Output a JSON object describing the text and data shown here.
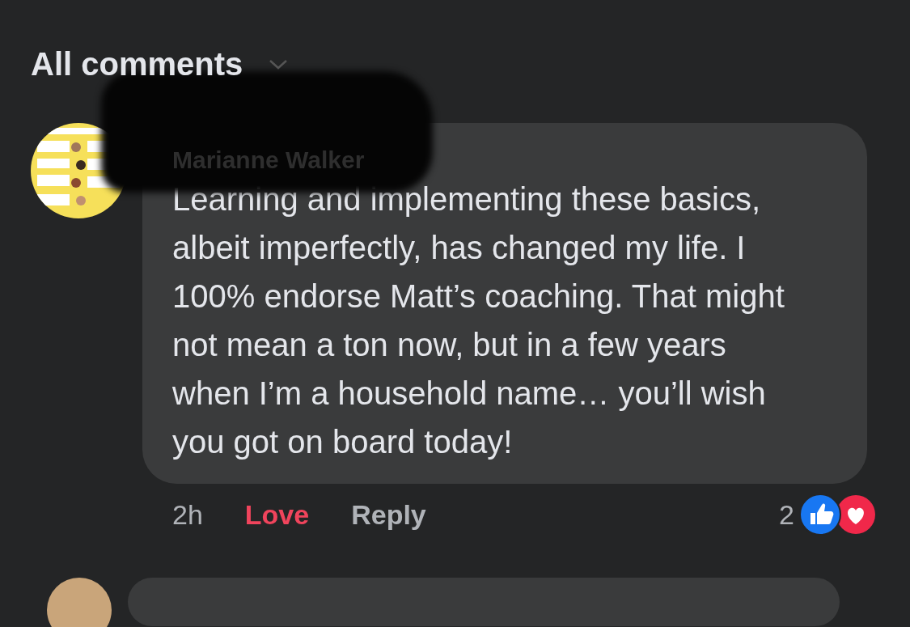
{
  "header": {
    "title": "All comments"
  },
  "comment": {
    "author": "Marianne Walker",
    "text": "Learning and implementing these basics, albeit imperfectly, has changed my life. I 100% endorse Matt’s coaching. That might not mean a ton now, but in a few years when I’m a household name… you’ll wish you got on board today!",
    "time": "2h",
    "actions": [
      {
        "label": "Love",
        "selected": true
      },
      {
        "label": "Reply",
        "selected": false
      }
    ],
    "reaction_count": "2"
  }
}
